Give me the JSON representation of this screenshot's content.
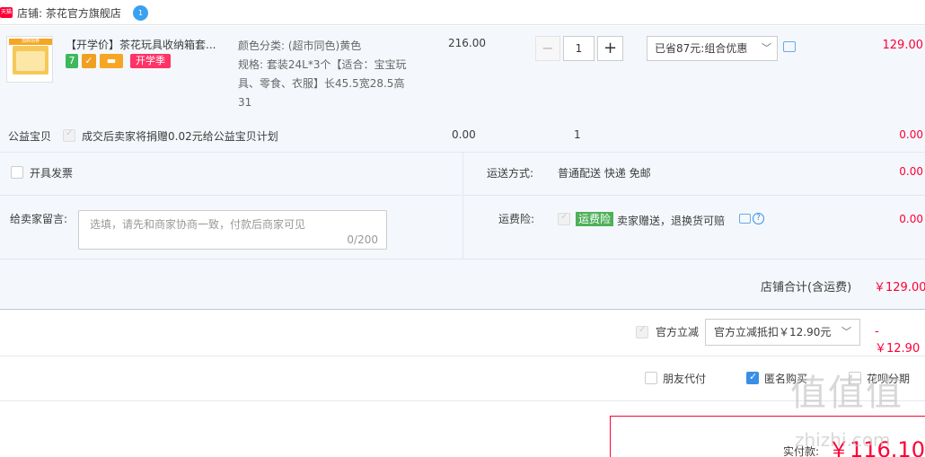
{
  "shop": {
    "badge": "天猫",
    "label": "店铺: 茶花官方旗舰店",
    "ww_icon": "1"
  },
  "item": {
    "thumb_tag": "加购领券",
    "title": "【开学价】茶花玩具收纳箱套...",
    "badges": [
      {
        "text": "7",
        "color": "#3db85c"
      },
      {
        "text": "✓",
        "color": "#f0a020"
      },
      {
        "text": "▬",
        "color": "#f6a623"
      },
      {
        "text": "开学季",
        "color": "#ff3366"
      }
    ],
    "sku_lines": [
      "颜色分类: (超市同色)黄色",
      "规格: 套装24L*3个【适合：宝宝玩具、零食、衣服】长45.5宽28.5高31"
    ],
    "price": "216.00",
    "quantity": "1",
    "qty_minus": "−",
    "qty_plus": "+",
    "promo": "已省87元:组合优惠",
    "subtotal": "129.00"
  },
  "charity": {
    "label": "公益宝贝",
    "text": "成交后卖家将捐赠0.02元给公益宝贝计划",
    "price": "0.00",
    "qty": "1",
    "amount": "0.00"
  },
  "invoice": {
    "label": "开具发票"
  },
  "shipping": {
    "label": "运送方式:",
    "value": "普通配送 快递 免邮",
    "amount": "0.00"
  },
  "remark": {
    "label": "给卖家留言:",
    "placeholder": "选填，请先和商家协商一致，付款后商家可见",
    "counter": "0/200"
  },
  "insurance": {
    "label": "运费险:",
    "tag": "运费险",
    "text": "卖家赠送，退换货可赔",
    "help": "?",
    "amount": "0.00"
  },
  "shop_total": {
    "label": "店铺合计(含运费)",
    "value": "￥129.00"
  },
  "discount": {
    "label": "官方立减",
    "select": "官方立减抵扣￥12.90元",
    "amount": "- ￥12.90"
  },
  "options": {
    "friend_pay": "朋友代付",
    "anonymous": "匿名购买",
    "huabei": "花呗分期"
  },
  "payment": {
    "label": "实付款:",
    "value": "￥116.10"
  },
  "watermark": {
    "main": "值值值",
    "sub": "zhizhi.com"
  },
  "colors": {
    "accent_red": "#ff0036",
    "blue": "#3a8ee6",
    "zone_bg": "#f4f8fc"
  }
}
